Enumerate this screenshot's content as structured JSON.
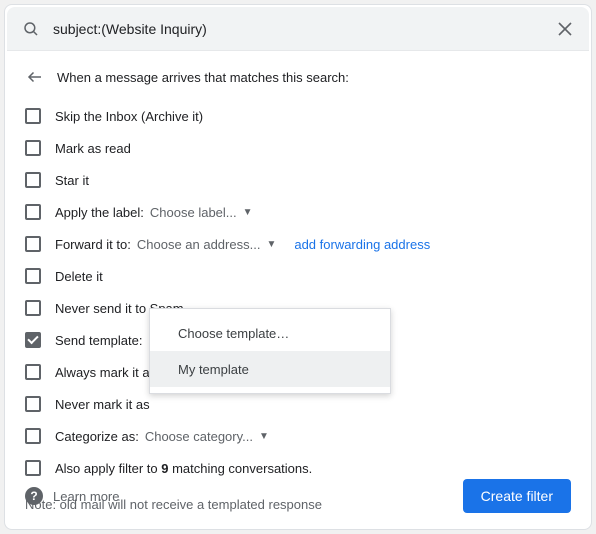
{
  "search": {
    "query": "subject:(Website Inquiry)"
  },
  "header": {
    "text": "When a message arrives that matches this search:"
  },
  "options": {
    "skip_inbox": "Skip the Inbox (Archive it)",
    "mark_read": "Mark as read",
    "star": "Star it",
    "apply_label": "Apply the label:",
    "apply_label_dd": "Choose label...",
    "forward": "Forward it to:",
    "forward_dd": "Choose an address...",
    "forward_link": "add forwarding address",
    "delete": "Delete it",
    "never_spam": "Never send it to Spam",
    "send_template": "Send template:",
    "always_important": "Always mark it a",
    "never_important": "Never mark it as",
    "categorize": "Categorize as:",
    "categorize_dd": "Choose category...",
    "also_apply_pre": "Also apply filter to ",
    "also_apply_count": "9",
    "also_apply_post": " matching conversations."
  },
  "template_menu": {
    "choose": "Choose template…",
    "item1": "My template"
  },
  "note": "Note: old mail will not receive a templated response",
  "footer": {
    "learn": "Learn more",
    "create": "Create filter"
  }
}
